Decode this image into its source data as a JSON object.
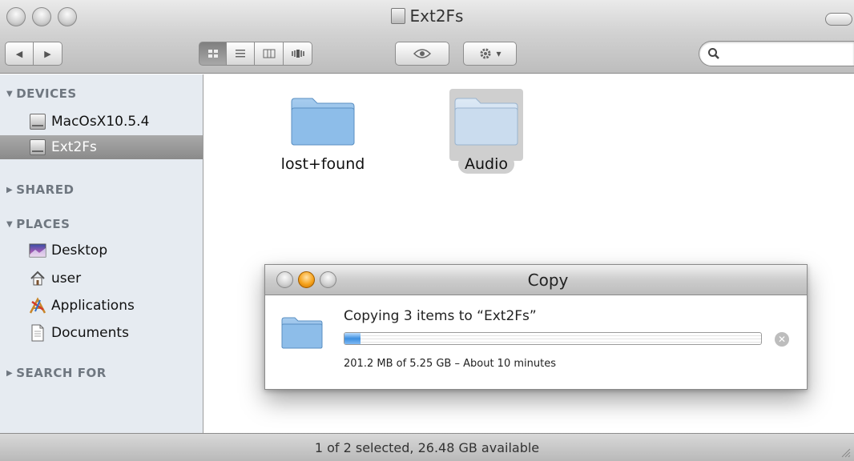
{
  "window": {
    "title": "Ext2Fs",
    "titlebar_icon": "hard-drive-icon"
  },
  "toolbar": {
    "back_glyph": "◀",
    "forward_glyph": "▶",
    "view_modes": [
      "icon-view",
      "list-view",
      "column-view",
      "coverflow-view"
    ],
    "active_view": "icon-view",
    "quicklook_icon": "eye-icon",
    "action_icon": "gear-icon",
    "action_caret": "▾",
    "search": {
      "value": "",
      "placeholder": ""
    }
  },
  "sidebar": {
    "devices": {
      "header": "DEVICES",
      "expanded": true,
      "items": [
        {
          "label": "MacOsX10.5.4",
          "icon": "hard-drive-icon"
        },
        {
          "label": "Ext2Fs",
          "icon": "hard-drive-icon",
          "selected": true
        }
      ]
    },
    "shared": {
      "header": "SHARED",
      "expanded": false
    },
    "places": {
      "header": "PLACES",
      "expanded": true,
      "items": [
        {
          "label": "Desktop",
          "icon": "desktop-icon"
        },
        {
          "label": "user",
          "icon": "home-icon"
        },
        {
          "label": "Applications",
          "icon": "applications-icon"
        },
        {
          "label": "Documents",
          "icon": "documents-icon"
        }
      ]
    },
    "search_for": {
      "header": "SEARCH FOR",
      "expanded": false
    }
  },
  "content": {
    "items": [
      {
        "name": "lost+found",
        "type": "folder",
        "selected": false
      },
      {
        "name": "Audio",
        "type": "folder",
        "selected": true
      }
    ]
  },
  "copy_dialog": {
    "title": "Copy",
    "message": "Copying 3 items to “Ext2Fs”",
    "progress": 0.038,
    "status": "201.2 MB of 5.25 GB – About 10 minutes",
    "stop_glyph": "✕"
  },
  "statusbar": {
    "text": "1 of 2 selected, 26.48 GB available"
  },
  "colors": {
    "sidebar_bg": "#e6ebf1",
    "selection_gray": "#cfcfcf",
    "progress_blue": "#3d8fe0",
    "dialog_active_button": "#f6a31c"
  }
}
